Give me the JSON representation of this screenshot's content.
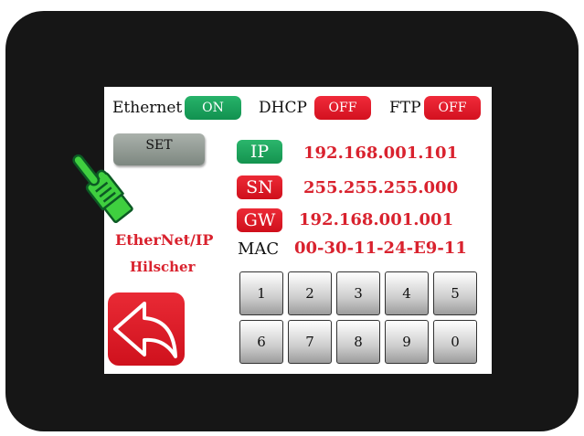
{
  "topbar": {
    "ethernet": {
      "label": "Ethernet",
      "state": "ON"
    },
    "dhcp": {
      "label": "DHCP",
      "state": "OFF"
    },
    "ftp": {
      "label": "FTP",
      "state": "OFF"
    }
  },
  "set_button": {
    "label": "SET"
  },
  "network": {
    "ip": {
      "tag": "IP",
      "value": "192.168.001.101"
    },
    "sn": {
      "tag": "SN",
      "value": "255.255.255.000"
    },
    "gw": {
      "tag": "GW",
      "value": "192.168.001.001"
    },
    "mac": {
      "tag": "MAC",
      "value": "00-30-11-24-E9-11"
    }
  },
  "brand": {
    "protocol": "EtherNet/IP",
    "vendor": "Hilscher"
  },
  "keypad": {
    "keys": [
      "1",
      "2",
      "3",
      "4",
      "5",
      "6",
      "7",
      "8",
      "9",
      "0"
    ]
  },
  "icons": {
    "pointer": "hand-pointer-icon",
    "back": "back-arrow-icon"
  },
  "colors": {
    "on": "#16a35a",
    "off": "#e11b28",
    "value_text": "#d9222e",
    "bezel": "#161616"
  }
}
